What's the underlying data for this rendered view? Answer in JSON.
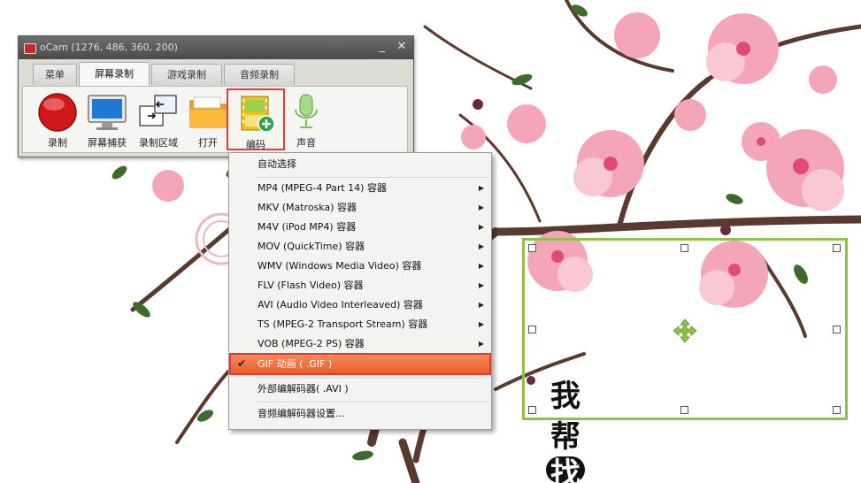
{
  "window": {
    "title": "oCam (1276, 486, 360, 200)",
    "minimize": "_",
    "close": "✕"
  },
  "tabs": [
    {
      "label": "菜单"
    },
    {
      "label": "屏幕录制"
    },
    {
      "label": "游戏录制"
    },
    {
      "label": "音频录制"
    }
  ],
  "toolbar": {
    "record": "录制",
    "screen_capture": "屏幕捕获",
    "record_area": "录制区域",
    "open": "打开",
    "encode": "编码",
    "sound": "声音"
  },
  "menu": {
    "auto_select": "自动选择",
    "items": [
      {
        "label": "MP4 (MPEG-4 Part 14) 容器"
      },
      {
        "label": "MKV (Matroska) 容器"
      },
      {
        "label": "M4V (iPod MP4) 容器"
      },
      {
        "label": "MOV (QuickTime) 容器"
      },
      {
        "label": "WMV (Windows Media Video) 容器"
      },
      {
        "label": "FLV (Flash Video) 容器"
      },
      {
        "label": "AVI (Audio Video Interleaved) 容器"
      },
      {
        "label": "TS (MPEG-2 Transport Stream) 容器"
      },
      {
        "label": "VOB (MPEG-2 PS) 容器"
      }
    ],
    "gif": "GIF 动画 ( .GIF )",
    "external": "外部编解码器( .AVI )",
    "audio_settings": "音频编解码器设置...",
    "check": "✔",
    "arrow": "▶"
  },
  "watermark": {
    "c1": "我",
    "c2": "帮",
    "c3": "找"
  },
  "colors": {
    "highlight": "#ec5f2c",
    "selection_border": "#8bc34a",
    "blossom": "#f4a6b8",
    "branch": "#5a3a2e"
  }
}
